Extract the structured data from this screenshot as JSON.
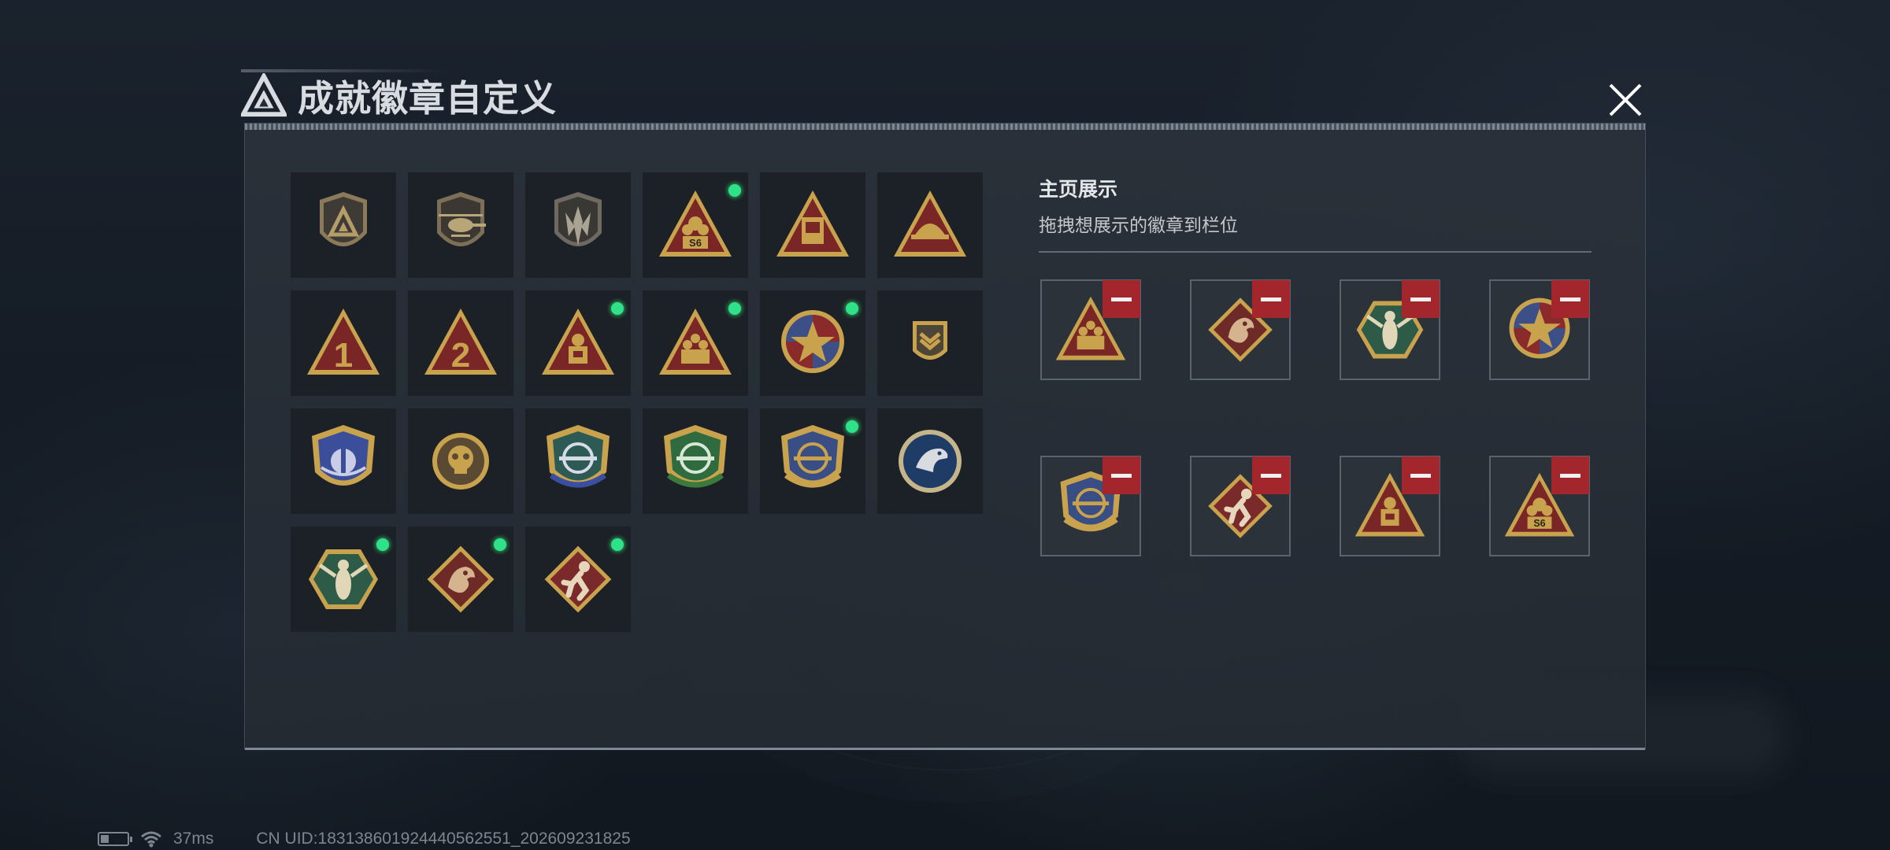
{
  "title": "成就徽章自定义",
  "display": {
    "title": "主页展示",
    "subtitle": "拖拽想展示的徽章到栏位"
  },
  "status": {
    "ping": "37ms",
    "uid": "CN UID:1831386019244405625​51_202609231825",
    "battery_level": 0.3
  },
  "colors": {
    "new_indicator": "#2fe28a",
    "remove_button": "#a3262d",
    "gold": "#c9a24e"
  },
  "badges": [
    {
      "icon": "shield-triangle-logo-icon",
      "new": false
    },
    {
      "icon": "helicopter-shield-icon",
      "new": false
    },
    {
      "icon": "blade-shield-icon",
      "new": false
    },
    {
      "icon": "triangle-s6-icon",
      "label": "S6",
      "new": true
    },
    {
      "icon": "triangle-keycard-icon",
      "new": false
    },
    {
      "icon": "triangle-helmet-icon",
      "new": false
    },
    {
      "icon": "triangle-number-one-icon",
      "label": "1",
      "new": false
    },
    {
      "icon": "triangle-number-two-icon",
      "label": "2",
      "new": false
    },
    {
      "icon": "triangle-soldier-icon",
      "new": true
    },
    {
      "icon": "triangle-squad-icon",
      "new": true
    },
    {
      "icon": "star-medal-icon",
      "new": true
    },
    {
      "icon": "rank-shield-icon",
      "new": false
    },
    {
      "icon": "blue-wing-shield-icon",
      "new": false
    },
    {
      "icon": "skull-emblem-icon",
      "new": false
    },
    {
      "icon": "rifle-crosshair-blue-icon",
      "new": false
    },
    {
      "icon": "rifle-crosshair-green-icon",
      "new": false
    },
    {
      "icon": "rifle-crosshair-gold-icon",
      "new": true
    },
    {
      "icon": "eagle-emblem-icon",
      "new": false
    },
    {
      "icon": "wasp-hexagon-icon",
      "new": true
    },
    {
      "icon": "dragon-diamond-icon",
      "new": true
    },
    {
      "icon": "runner-diamond-icon",
      "new": true
    }
  ],
  "showcase": [
    {
      "icon": "triangle-squad-icon"
    },
    {
      "icon": "dragon-diamond-icon"
    },
    {
      "icon": "wasp-hexagon-icon"
    },
    {
      "icon": "star-medal-icon"
    },
    {
      "icon": "rifle-crosshair-gold-icon"
    },
    {
      "icon": "runner-diamond-icon"
    },
    {
      "icon": "triangle-soldier-icon"
    },
    {
      "icon": "triangle-s6-icon",
      "label": "S6"
    }
  ]
}
